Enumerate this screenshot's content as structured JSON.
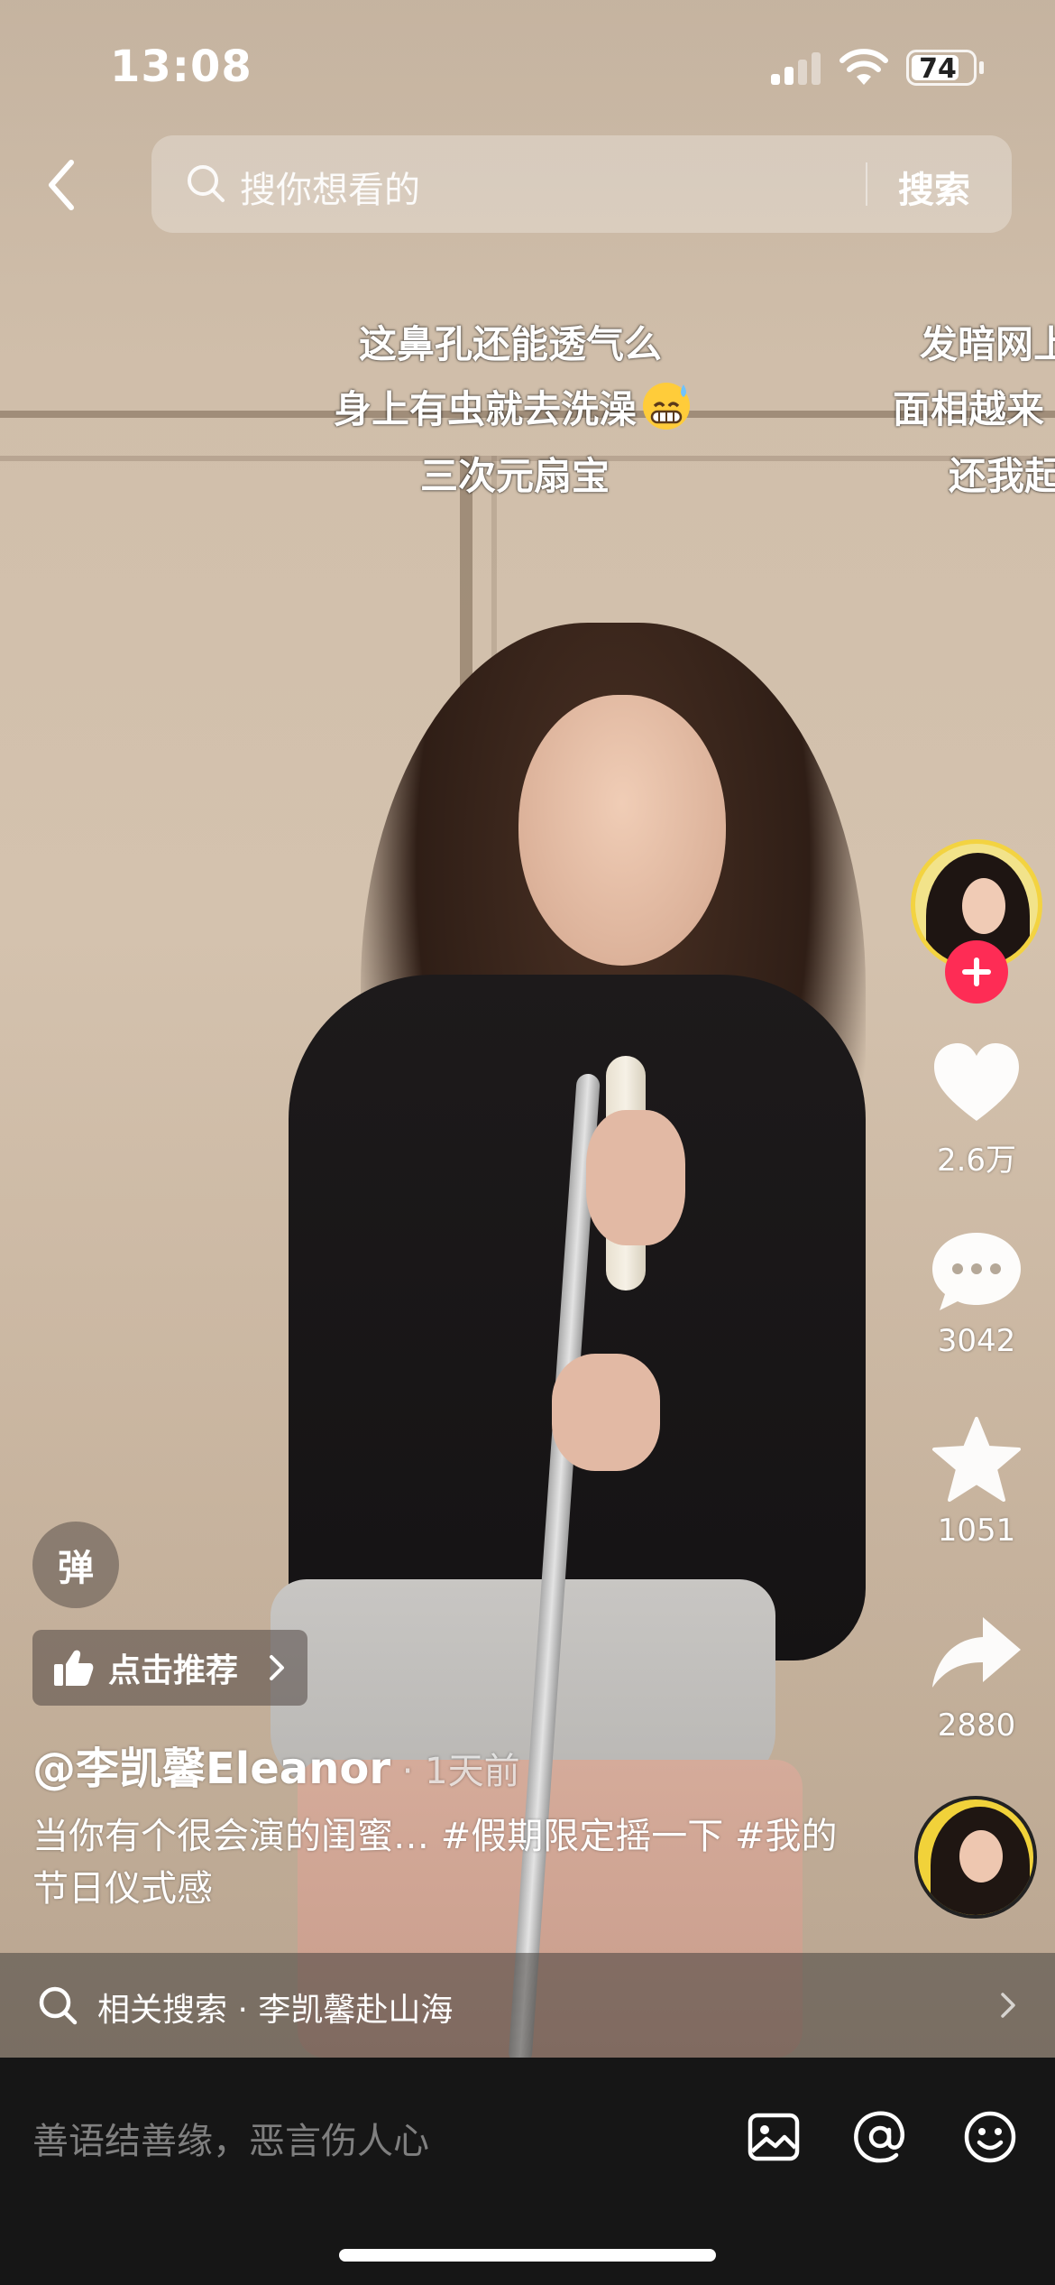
{
  "status_bar": {
    "time": "13:08",
    "battery": "74"
  },
  "search": {
    "placeholder": "搜你想看的",
    "button": "搜索"
  },
  "danmaku": [
    {
      "text": "这鼻孔还能透气么"
    },
    {
      "text": "身上有虫就去洗澡"
    },
    {
      "text": "三次元扇宝"
    },
    {
      "text": "发暗网上"
    },
    {
      "text": "面相越来"
    },
    {
      "text": "还我起"
    }
  ],
  "rail": {
    "likes": "2.6万",
    "comments": "3042",
    "favorites": "1051",
    "shares": "2880"
  },
  "danmu_toggle": "弹",
  "recommend": {
    "label": "点击推荐"
  },
  "video": {
    "author": "@李凯馨Eleanor",
    "time_ago": " · 1天前",
    "caption": "当你有个很会演的闺蜜… #假期限定摇一下 #我的节日仪式感"
  },
  "related": {
    "text": "相关搜索 · 李凯馨赴山海"
  },
  "comment_bar": {
    "placeholder": "善语结善缘，恶言伤人心"
  },
  "colors": {
    "accent": "#fe2c55",
    "avatar_ring": "#f3d341"
  }
}
